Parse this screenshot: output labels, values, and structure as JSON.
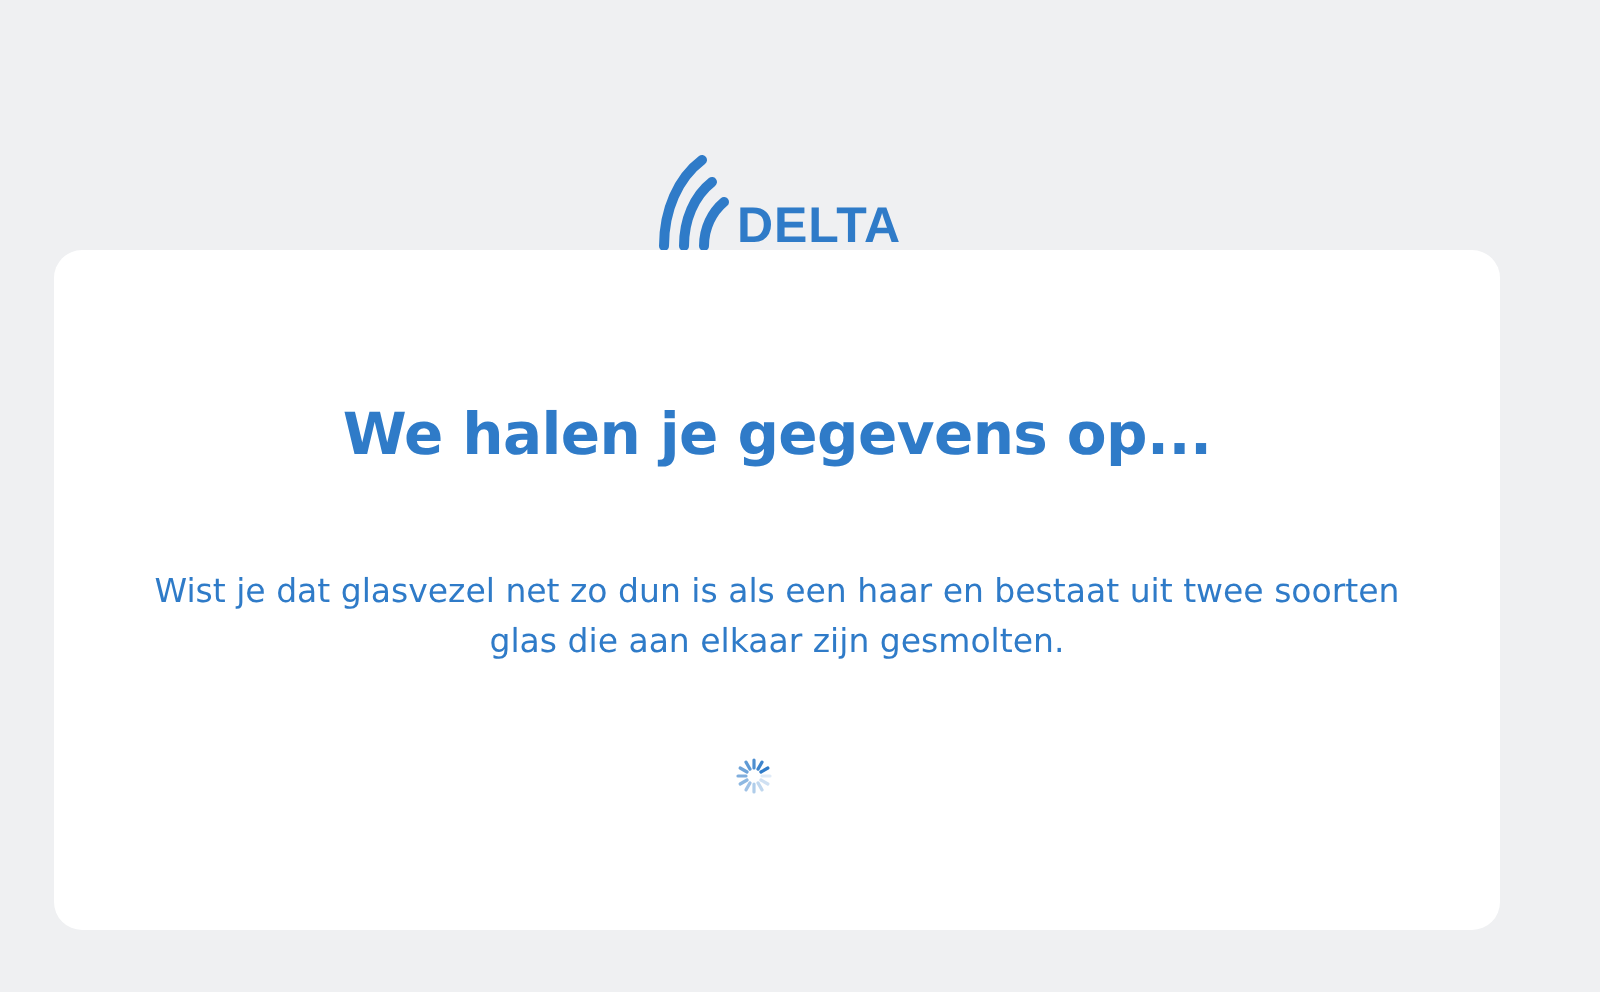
{
  "logo": {
    "text": "DELTA"
  },
  "card": {
    "title": "We halen je gegevens op...",
    "message": "Wist je dat glasvezel net zo dun is als een haar en bestaat uit twee soorten glas die aan elkaar zijn gesmolten.",
    "loading": true
  }
}
